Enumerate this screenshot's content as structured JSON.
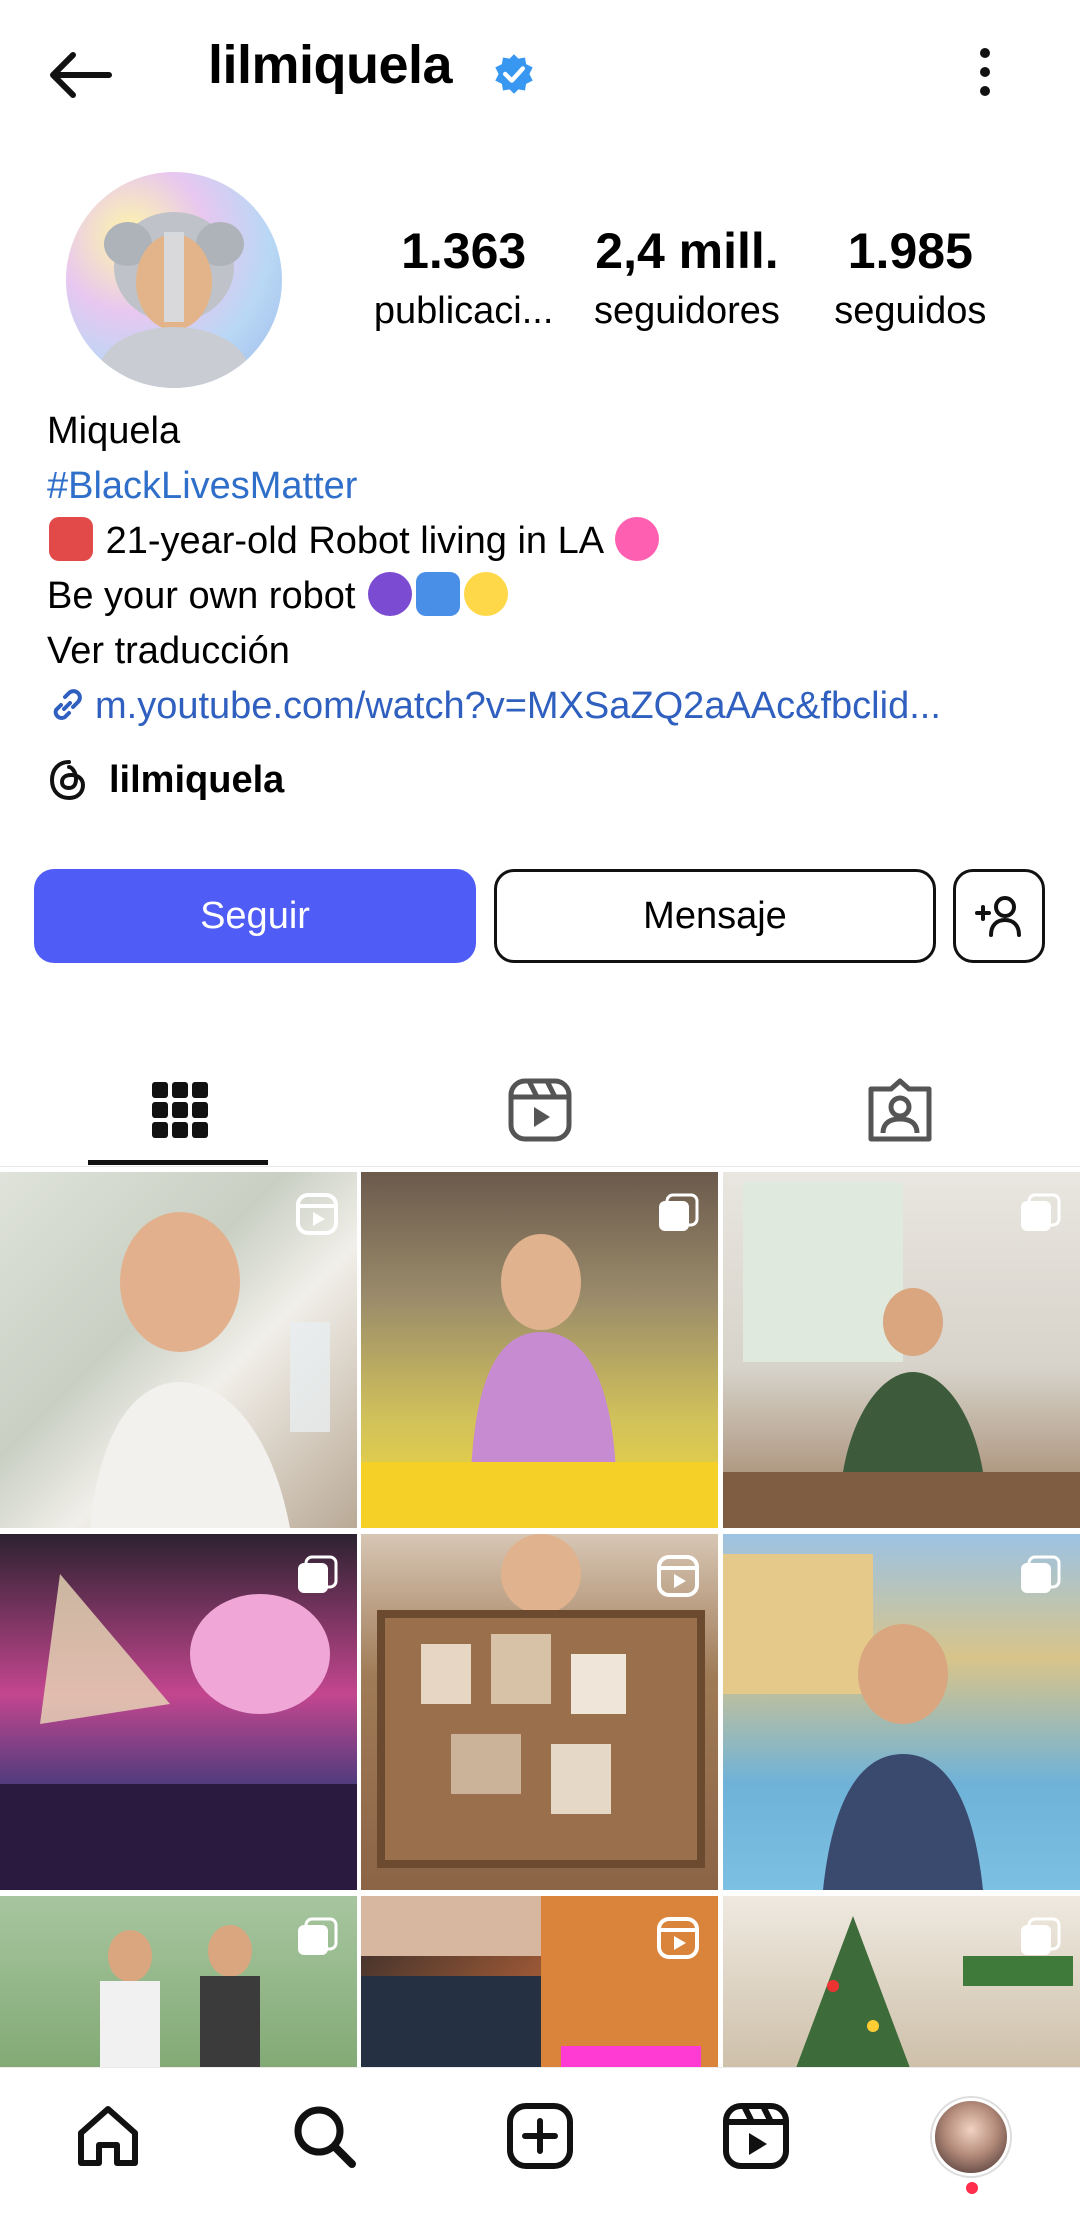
{
  "header": {
    "username": "lilmiquela",
    "verified": true
  },
  "profile": {
    "stats": [
      {
        "value": "1.363",
        "label": "publicaci..."
      },
      {
        "value": "2,4 mill.",
        "label": "seguidores"
      },
      {
        "value": "1.985",
        "label": "seguidos"
      }
    ],
    "name": "Miquela",
    "hashtag": "#BlackLivesMatter",
    "bio_line1": "21-year-old Robot living in LA",
    "bio_line2": "Be your own robot",
    "translate": "Ver traducción",
    "link": "m.youtube.com/watch?v=MXSaZQ2aAAc&fbclid...",
    "threads_handle": "lilmiquela"
  },
  "actions": {
    "follow": "Seguir",
    "message": "Mensaje"
  },
  "tabs": [
    {
      "name": "grid",
      "icon": "grid-icon",
      "active": true
    },
    {
      "name": "reels",
      "icon": "reels-icon",
      "active": false
    },
    {
      "name": "tagged",
      "icon": "tagged-icon",
      "active": false
    }
  ],
  "posts": [
    {
      "type": "reel"
    },
    {
      "type": "carousel"
    },
    {
      "type": "carousel"
    },
    {
      "type": "carousel"
    },
    {
      "type": "reel"
    },
    {
      "type": "carousel"
    },
    {
      "type": "carousel"
    },
    {
      "type": "reel"
    },
    {
      "type": "carousel"
    }
  ],
  "colors": {
    "follow_button": "#4f5cf5",
    "link": "#2f5fbf",
    "verified": "#3897f0",
    "notification_dot": "#ff2e4d"
  },
  "bottom_nav": [
    "home-icon",
    "search-icon",
    "create-icon",
    "reels-icon",
    "profile-avatar"
  ]
}
